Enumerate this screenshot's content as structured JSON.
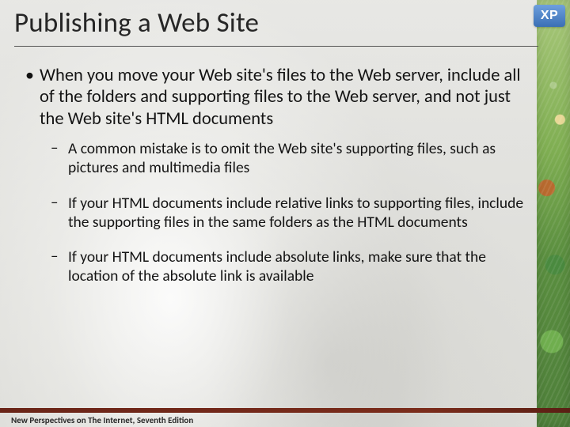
{
  "title": "Publishing a Web Site",
  "badge": "XP",
  "bullets": {
    "main": "When you move your Web site's files to the Web server, include all of the folders and supporting files to the Web server, and not just the Web site's HTML documents",
    "subs": [
      "A common mistake is to omit the Web site's supporting files, such as pictures and multimedia files",
      "If your HTML documents include relative links to supporting files, include the supporting files in the same folders as the HTML documents",
      "If your HTML documents include absolute links, make sure that the location of the absolute link is available"
    ]
  },
  "footer": "New Perspectives on The Internet, Seventh Edition"
}
